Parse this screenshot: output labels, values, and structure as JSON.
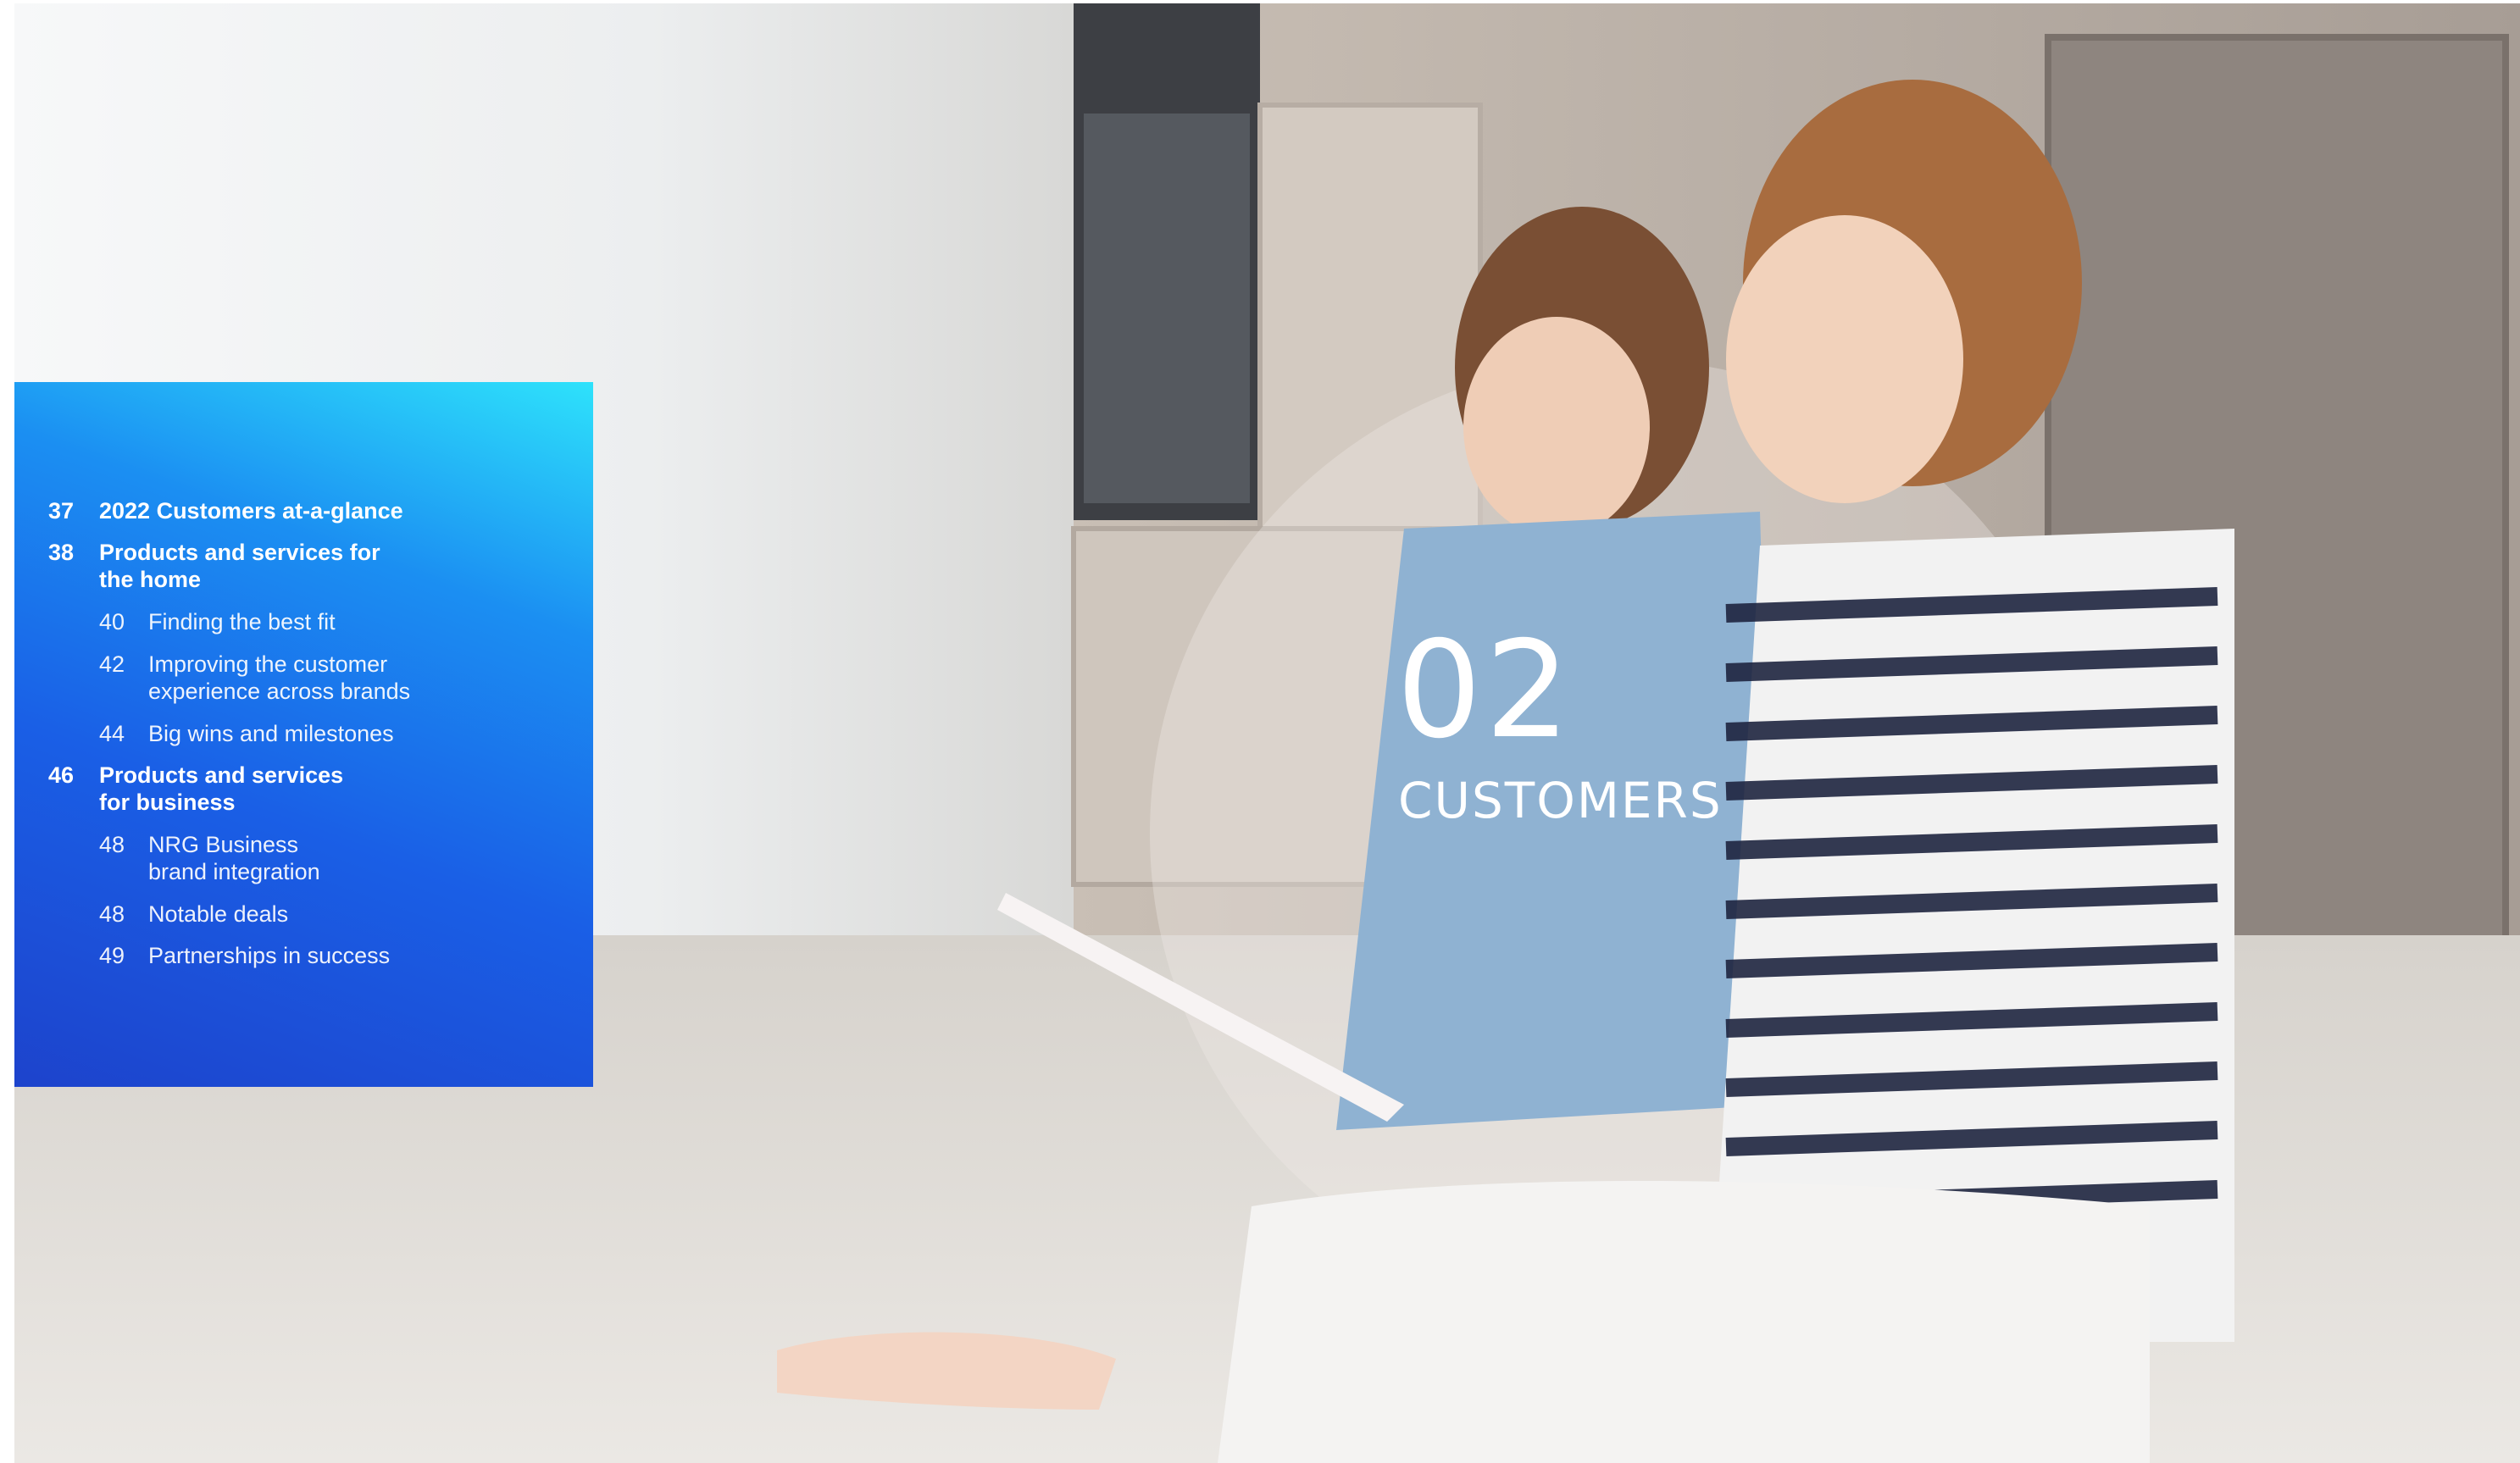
{
  "toc": {
    "items": [
      {
        "num": "37",
        "label": "2022 Customers at-a-glance",
        "level": "primary"
      },
      {
        "num": "38",
        "label": "Products and services for\nthe home",
        "level": "primary"
      },
      {
        "num": "40",
        "label": "Finding the best fit",
        "level": "secondary"
      },
      {
        "num": "42",
        "label": "Improving the customer\nexperience across brands",
        "level": "secondary"
      },
      {
        "num": "44",
        "label": "Big wins and milestones",
        "level": "secondary"
      },
      {
        "num": "46",
        "label": "Products and services\nfor business",
        "level": "primary"
      },
      {
        "num": "48",
        "label": "NRG Business\nbrand integration",
        "level": "secondary"
      },
      {
        "num": "48",
        "label": "Notable deals",
        "level": "secondary"
      },
      {
        "num": "49",
        "label": "Partnerships in success",
        "level": "secondary"
      }
    ]
  },
  "section": {
    "number": "02",
    "title": "CUSTOMERS"
  },
  "colors": {
    "panel_top": "#2ee2fb",
    "panel_bottom": "#1d43cc",
    "text": "#ffffff"
  }
}
